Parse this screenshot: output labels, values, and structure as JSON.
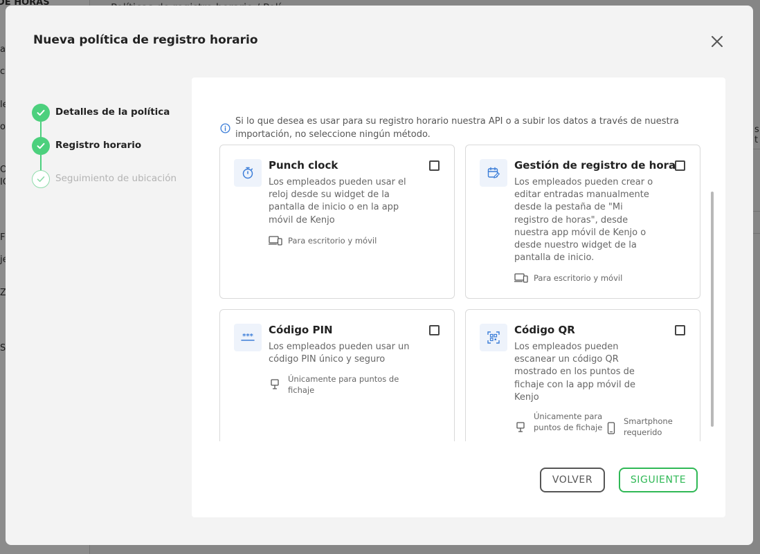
{
  "background": {
    "breadcrumb": "Políticas de registro horario / Polí...",
    "sidebar_fragments": [
      "DE HORAS",
      "al",
      "c",
      "le",
      "or",
      "O",
      "IC",
      "FI",
      "je",
      "Z",
      "S"
    ],
    "right_fragment": "s t"
  },
  "modal": {
    "title": "Nueva política de registro horario",
    "close_icon": "close-icon"
  },
  "stepper": {
    "steps": [
      {
        "label": "Detalles de la política",
        "state": "done"
      },
      {
        "label": "Registro horario",
        "state": "active"
      },
      {
        "label": "Seguimiento de ubicación",
        "state": "pending"
      }
    ]
  },
  "content": {
    "info_text": "Si lo que desea es usar para su registro horario nuestra API o a subir los datos a través de nuestra importación, no seleccione ningún método.",
    "cards": [
      {
        "icon": "stopwatch-icon",
        "title": "Punch clock",
        "description": "Los empleados pueden usar el reloj desde su widget de la pantalla de inicio o en la app móvil de Kenjo",
        "platforms": [
          {
            "icon": "devices-icon",
            "label": "Para escritorio y móvil"
          }
        ],
        "checked": false
      },
      {
        "icon": "calendar-edit-icon",
        "title": "Gestión de registro de horas",
        "description": "Los empleados pueden crear o editar entradas manualmente desde la pestaña de \"Mi registro de horas\", desde nuestra app móvil de Kenjo o desde nuestro widget de la pantalla de inicio.",
        "platforms": [
          {
            "icon": "devices-icon",
            "label": "Para escritorio y móvil"
          }
        ],
        "checked": false
      },
      {
        "icon": "pin-code-icon",
        "title": "Código PIN",
        "description": "Los empleados pueden usar un código PIN único y seguro",
        "platforms": [
          {
            "icon": "kiosk-icon",
            "label": "Únicamente para puntos de fichaje"
          }
        ],
        "checked": false
      },
      {
        "icon": "qr-code-icon",
        "title": "Código QR",
        "description": "Los empleados pueden escanear un código QR mostrado en los puntos de fichaje con la app móvil de Kenjo",
        "platforms": [
          {
            "icon": "kiosk-icon",
            "label": "Únicamente para puntos de fichaje"
          },
          {
            "icon": "smartphone-icon",
            "label": "Smartphone requerido"
          }
        ],
        "checked": false
      }
    ]
  },
  "footer": {
    "back_label": "VOLVER",
    "next_label": "SIGUIENTE"
  },
  "colors": {
    "success_green": "#4cd07d",
    "button_green": "#2fb855",
    "icon_blue": "#3b7dd8"
  }
}
